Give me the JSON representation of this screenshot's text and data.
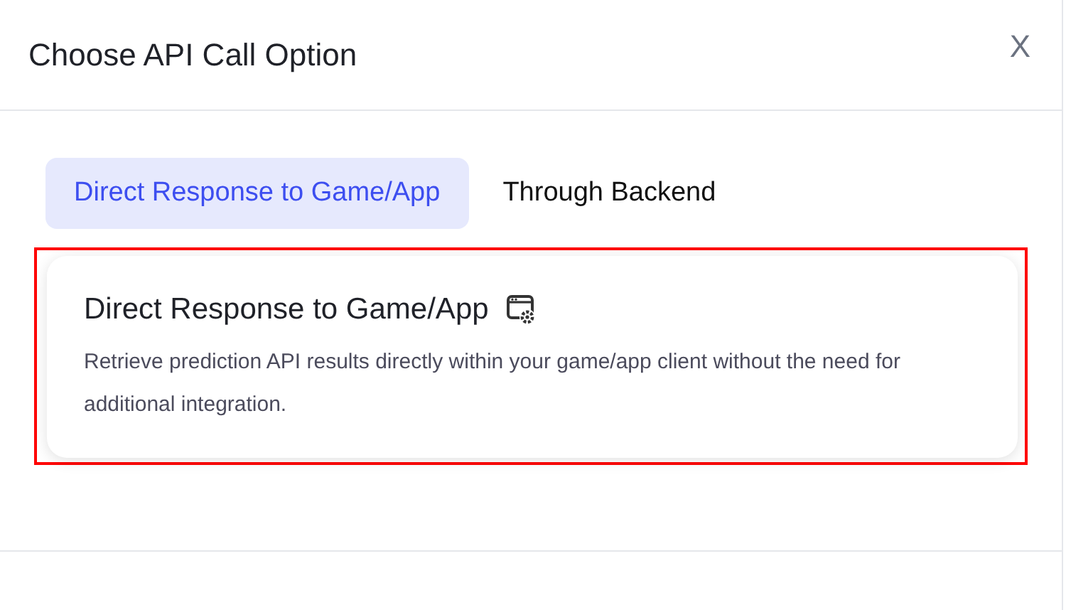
{
  "dialog": {
    "title": "Choose API Call Option",
    "close": "X"
  },
  "tabs": [
    {
      "label": "Direct Response to Game/App",
      "selected": true
    },
    {
      "label": "Through Backend",
      "selected": false
    }
  ],
  "card": {
    "title": "Direct Response to Game/App",
    "description": "Retrieve prediction API results directly within your game/app client without the need for additional integration.",
    "highlighted": true
  }
}
